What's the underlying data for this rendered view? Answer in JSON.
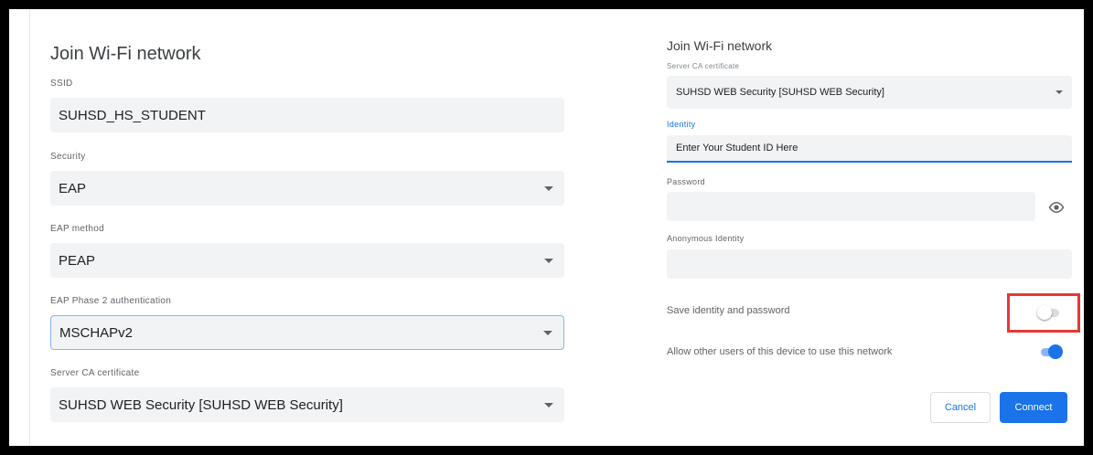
{
  "left": {
    "title": "Join Wi-Fi network",
    "ssid": {
      "label": "SSID",
      "value": "SUHSD_HS_STUDENT"
    },
    "security": {
      "label": "Security",
      "value": "EAP"
    },
    "eap_method": {
      "label": "EAP method",
      "value": "PEAP"
    },
    "phase2": {
      "label": "EAP Phase 2 authentication",
      "value": "MSCHAPv2"
    },
    "server_ca": {
      "label": "Server CA certificate",
      "value": "SUHSD WEB Security [SUHSD WEB Security]"
    }
  },
  "right": {
    "title": "Join Wi-Fi network",
    "server_ca": {
      "label": "Server CA certificate",
      "value": "SUHSD WEB Security [SUHSD WEB Security]"
    },
    "identity": {
      "label": "Identity",
      "value": "Enter Your Student ID Here"
    },
    "password": {
      "label": "Password",
      "value": ""
    },
    "anonymous_identity": {
      "label": "Anonymous Identity",
      "value": ""
    },
    "save_identity": {
      "label": "Save identity and password",
      "enabled": false
    },
    "share_network": {
      "label": "Allow other users of this device to use this network",
      "enabled": true
    },
    "buttons": {
      "cancel": "Cancel",
      "connect": "Connect"
    }
  },
  "icons": {
    "dropdown": "chevron-down-icon",
    "show_password": "eye-icon"
  },
  "colors": {
    "accent": "#1a73e8",
    "field_bg": "#f1f3f4",
    "highlight": "#e53935"
  }
}
